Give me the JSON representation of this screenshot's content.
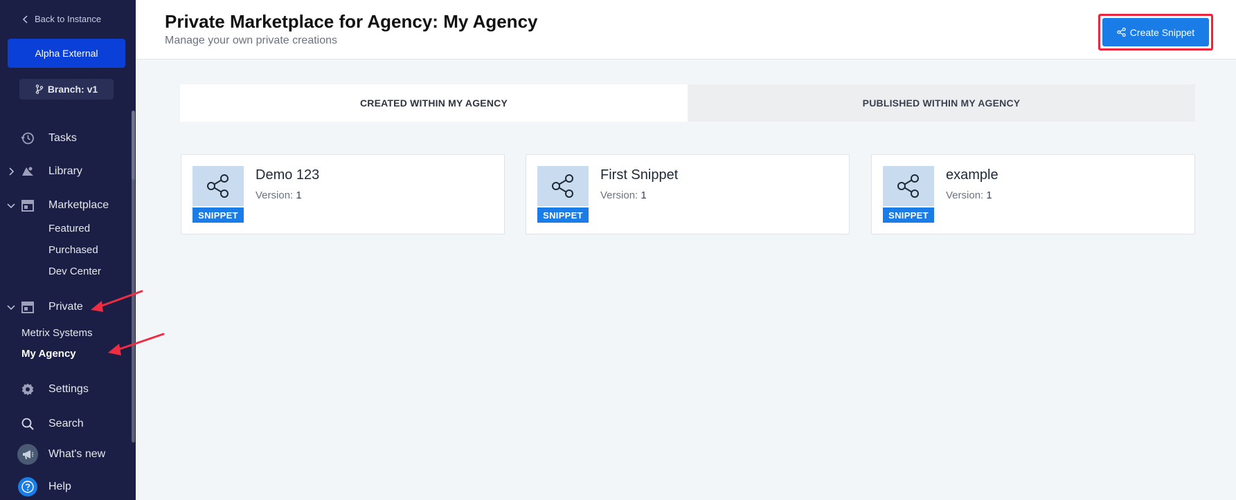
{
  "sidebar": {
    "back_label": "Back to Instance",
    "instance_label": "Alpha External",
    "branch_label": "Branch: v1",
    "items": {
      "tasks": "Tasks",
      "library": "Library",
      "marketplace": "Marketplace",
      "private": "Private",
      "settings": "Settings",
      "search": "Search",
      "whats_new": "What's new",
      "help": "Help"
    },
    "marketplace_sub": [
      "Featured",
      "Purchased",
      "Dev Center"
    ],
    "private_sub": [
      "Metrix Systems",
      "My Agency"
    ]
  },
  "header": {
    "title": "Private Marketplace for Agency: My Agency",
    "subtitle": "Manage your own private creations",
    "create_label": "Create Snippet"
  },
  "tabs": [
    {
      "label": "CREATED WITHIN MY AGENCY",
      "active": true
    },
    {
      "label": "PUBLISHED WITHIN MY AGENCY",
      "active": false
    }
  ],
  "cards": [
    {
      "name": "Demo 123",
      "version_label": "Version:",
      "version": "1",
      "badge": "SNIPPET"
    },
    {
      "name": "First Snippet",
      "version_label": "Version:",
      "version": "1",
      "badge": "SNIPPET"
    },
    {
      "name": "example",
      "version_label": "Version:",
      "version": "1",
      "badge": "SNIPPET"
    }
  ],
  "colors": {
    "sidebar_bg": "#1b1f46",
    "accent": "#1a7ce6",
    "highlight": "#ef233c"
  }
}
